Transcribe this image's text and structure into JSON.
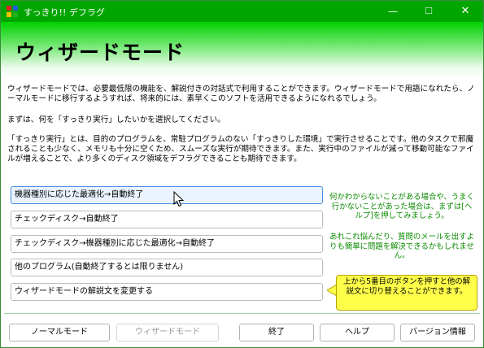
{
  "window": {
    "title": "すっきり!! デフラグ",
    "icon": "defrag-app-icon",
    "controls": {
      "minimize": "—",
      "maximize": "☐",
      "close": "✕"
    }
  },
  "header": {
    "title": "ウィザードモード"
  },
  "intro": {
    "paragraph1": "ウィザードモードでは、必要最低限の機能を、解説付きの対話式で利用することができます。ウィザードモードで用語になれたら、ノーマルモードに移行するようすれば、将来的には、素早くこのソフトを活用できるようになれるでしょう。",
    "paragraph2": "まずは、何を「すっきり実行」したいかを選択してください。",
    "paragraph3": "「すっきり実行」とは、目的のプログラムを、常駐プログラムのない「すっきりした環境」で実行させることです。他のタスクで邪魔されることも少なく、メモリも十分に空くため、スムーズな実行が期待できます。また、実行中のファイルが減って移動可能なファイルが増えることで、より多くのディスク領域をデフラグできることも期待できます。"
  },
  "options": [
    {
      "label": "機器種別に応じた最適化→自動終了"
    },
    {
      "label": "チェックディスク→自動終了"
    },
    {
      "label": "チェックディスク→機器種別に応じた最適化→自動終了"
    },
    {
      "label": "他のプログラム(自動終了するとは限りません)"
    },
    {
      "label": "ウィザードモードの解説文を変更する"
    }
  ],
  "hints": {
    "help_hint": "何かわからないことがある場合や、うまく行かないことがあった場合は、まずは[ヘルプ]を押してみましょう。",
    "mail_hint": "あれこれ悩んだり、質問のメールを出すよりも簡単に問題を解決できるかもしれません。",
    "tip": "上から5番目のボタンを押すと他の解説文に切り替えることができます。"
  },
  "footer": {
    "normal_mode": "ノーマルモード",
    "wizard_mode": "ウィザードモード",
    "exit": "終了",
    "help": "ヘルプ",
    "version": "バージョン情報"
  },
  "colors": {
    "titlebar": "#00a500",
    "header_gradient_top": "#00d000",
    "hint_text": "#0a8a00",
    "tip_background": "#ffff4a",
    "active_option_border": "#4a8de0"
  }
}
